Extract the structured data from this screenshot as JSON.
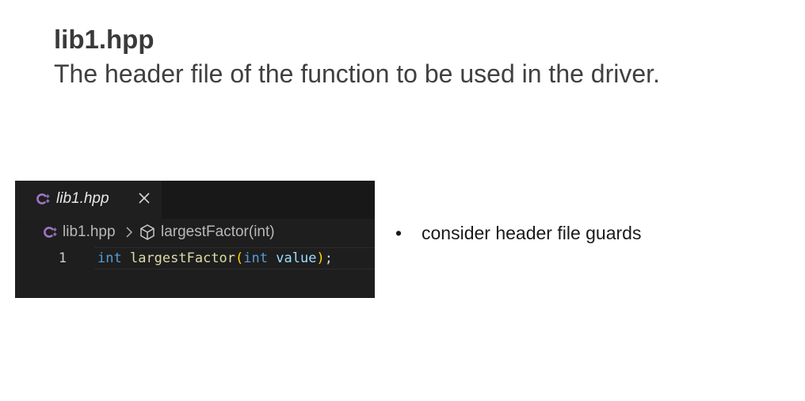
{
  "slide": {
    "title": "lib1.hpp",
    "subtitle": "The header file of the function to be used in the driver."
  },
  "editor": {
    "tab": {
      "label": "lib1.hpp",
      "icon": "cpp-file-icon",
      "close_icon": "close-icon",
      "close_glyph": "✕"
    },
    "breadcrumb": {
      "file": "lib1.hpp",
      "separator_icon": "chevron-right-icon",
      "symbol_icon": "method-cube-icon",
      "symbol": "largestFactor(int)"
    },
    "lines": [
      {
        "number": "1",
        "tokens": {
          "kw1": "int",
          "fn": "largestFactor",
          "open": "(",
          "kw2": "int",
          "param": "value",
          "close": ")",
          "semi": ";"
        }
      }
    ],
    "colors": {
      "background": "#1e1e1e",
      "keyword": "#569cd6",
      "function": "#dcdcaa",
      "bracket": "#ffd700",
      "parameter": "#9cdcfe",
      "icon_accent": "#a074c4"
    }
  },
  "notes": {
    "bullets": [
      "consider header file guards"
    ]
  }
}
